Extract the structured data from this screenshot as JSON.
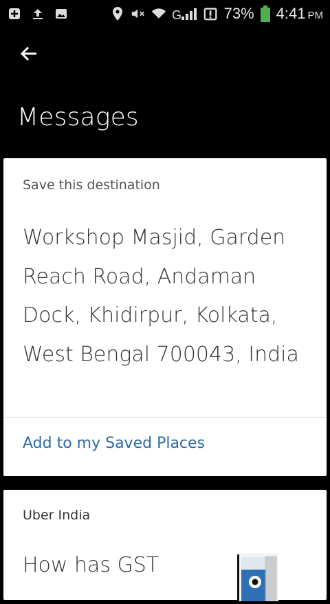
{
  "status_bar": {
    "icons": [
      "add-box-icon",
      "upload-icon",
      "image-icon",
      "location-icon",
      "mute-icon",
      "wifi-icon",
      "signal-icon",
      "notification-icon",
      "battery-icon"
    ],
    "battery": "73%",
    "time": "4:41",
    "ampm": "PM",
    "signal_label": "G"
  },
  "header": {
    "back_icon": "arrow-left-icon",
    "title": "Messages"
  },
  "cards": [
    {
      "header": "Save this destination",
      "body": "Workshop Masjid, Garden Reach Road, Andaman Dock, Khidirpur, Kolkata, West Bengal 700043, India",
      "action": "Add to my Saved Places"
    },
    {
      "header": "Uber India",
      "body": "How has GST"
    }
  ],
  "colors": {
    "background": "#000000",
    "card": "#ffffff",
    "link": "#2e6aa8",
    "battery": "#4caf50"
  }
}
